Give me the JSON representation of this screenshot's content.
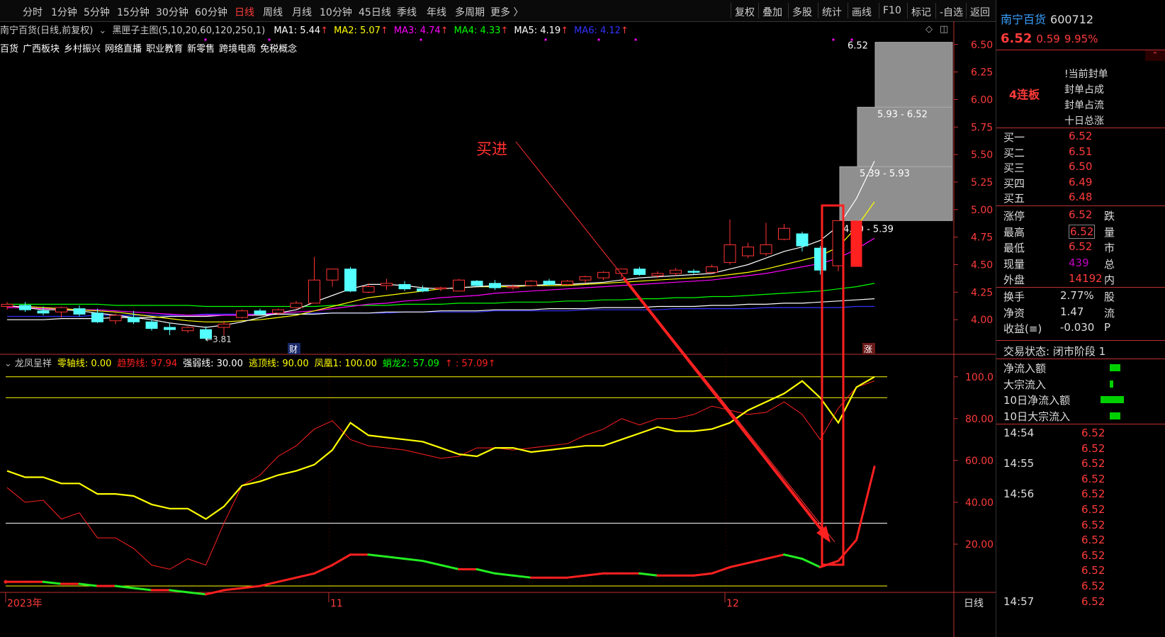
{
  "toolbar": {
    "periods": [
      "分时",
      "1分钟",
      "5分钟",
      "15分钟",
      "30分钟",
      "60分钟",
      "日线",
      "周线",
      "月线",
      "10分钟",
      "45日线",
      "季线",
      "年线",
      "多周期",
      "更多 〉"
    ],
    "active_period": "日线",
    "tools": [
      "复权",
      "叠加",
      "多股",
      "统计",
      "画线",
      "F10",
      "标记",
      "-自选",
      "返回"
    ]
  },
  "main_info": {
    "title": "南宁百货(日线,前复权)",
    "indicator": "黑匣子主图(5,10,20,60,120,250,1)",
    "ma": [
      {
        "label": "MA1: 5.44",
        "color": "#ffffff"
      },
      {
        "label": "MA2: 5.07",
        "color": "#ffff00"
      },
      {
        "label": "MA3: 4.74",
        "color": "#ff00ff"
      },
      {
        "label": "MA4: 4.33",
        "color": "#00ff00"
      },
      {
        "label": "MA5: 4.19",
        "color": "#ffffff"
      },
      {
        "label": "MA6: 4.12",
        "color": "#3333ff"
      }
    ]
  },
  "concepts": [
    "百货",
    "广西板块",
    "乡村振兴",
    "网络直播",
    "职业教育",
    "新零售",
    "跨境电商",
    "免税概念"
  ],
  "price_axis": [
    "6.50",
    "6.25",
    "6.00",
    "5.75",
    "5.50",
    "5.25",
    "5.00",
    "4.75",
    "4.50",
    "4.25",
    "4.00"
  ],
  "indicator_axis": [
    "100.0",
    "80.00",
    "60.00",
    "40.00",
    "20.00"
  ],
  "x_axis": [
    "2023年",
    "11",
    "12",
    "日线"
  ],
  "annotations": {
    "buy": "买进",
    "low": "3.81",
    "cai": "财",
    "zhang": "涨"
  },
  "ladder": [
    {
      "label": "6.52"
    },
    {
      "label": "5.93 - 6.52"
    },
    {
      "label": "5.39 - 5.93"
    },
    {
      "label": "4.90 - 5.39"
    }
  ],
  "indicator_legend": [
    {
      "label": "龙凤呈祥",
      "color": "#cccccc"
    },
    {
      "label": "零轴线: 0.00",
      "color": "#ffff00"
    },
    {
      "label": "趋势线: 97.94",
      "color": "#ff2020"
    },
    {
      "label": "强弱线: 30.00",
      "color": "#ffffff"
    },
    {
      "label": "逃顶线: 90.00",
      "color": "#ffff00"
    },
    {
      "label": "凤凰1: 100.00",
      "color": "#ffff00"
    },
    {
      "label": "蛸龙2: 57.09",
      "color": "#00ff00"
    },
    {
      "label": "↑ : 57.09↑",
      "color": "#ff2020"
    }
  ],
  "chart_data": {
    "type": "candlestick",
    "price_range": [
      3.75,
      6.55
    ],
    "candles": [
      {
        "o": 4.12,
        "h": 4.16,
        "l": 4.09,
        "c": 4.14
      },
      {
        "o": 4.13,
        "h": 4.16,
        "l": 4.07,
        "c": 4.09
      },
      {
        "o": 4.08,
        "h": 4.12,
        "l": 4.04,
        "c": 4.06
      },
      {
        "o": 4.07,
        "h": 4.12,
        "l": 4.02,
        "c": 4.11
      },
      {
        "o": 4.1,
        "h": 4.13,
        "l": 4.03,
        "c": 4.05
      },
      {
        "o": 4.06,
        "h": 4.1,
        "l": 3.97,
        "c": 3.98
      },
      {
        "o": 3.99,
        "h": 4.06,
        "l": 3.96,
        "c": 4.04
      },
      {
        "o": 4.02,
        "h": 4.08,
        "l": 3.96,
        "c": 3.98
      },
      {
        "o": 3.98,
        "h": 4.0,
        "l": 3.9,
        "c": 3.92
      },
      {
        "o": 3.93,
        "h": 3.97,
        "l": 3.86,
        "c": 3.91
      },
      {
        "o": 3.9,
        "h": 3.94,
        "l": 3.88,
        "c": 3.93
      },
      {
        "o": 3.91,
        "h": 3.94,
        "l": 3.81,
        "c": 3.83
      },
      {
        "o": 3.93,
        "h": 3.99,
        "l": 3.86,
        "c": 3.96
      },
      {
        "o": 4.02,
        "h": 4.09,
        "l": 4.01,
        "c": 4.08
      },
      {
        "o": 4.08,
        "h": 4.1,
        "l": 4.04,
        "c": 4.05
      },
      {
        "o": 4.06,
        "h": 4.1,
        "l": 4.04,
        "c": 4.09
      },
      {
        "o": 4.11,
        "h": 4.17,
        "l": 4.1,
        "c": 4.15
      },
      {
        "o": 4.15,
        "h": 4.57,
        "l": 4.15,
        "c": 4.36
      },
      {
        "o": 4.36,
        "h": 4.45,
        "l": 4.3,
        "c": 4.46
      },
      {
        "o": 4.46,
        "h": 4.48,
        "l": 4.25,
        "c": 4.26
      },
      {
        "o": 4.25,
        "h": 4.33,
        "l": 4.24,
        "c": 4.3
      },
      {
        "o": 4.31,
        "h": 4.37,
        "l": 4.27,
        "c": 4.33
      },
      {
        "o": 4.32,
        "h": 4.35,
        "l": 4.26,
        "c": 4.28
      },
      {
        "o": 4.28,
        "h": 4.31,
        "l": 4.25,
        "c": 4.26
      },
      {
        "o": 4.28,
        "h": 4.3,
        "l": 4.26,
        "c": 4.29
      },
      {
        "o": 4.26,
        "h": 4.37,
        "l": 4.26,
        "c": 4.36
      },
      {
        "o": 4.35,
        "h": 4.36,
        "l": 4.3,
        "c": 4.31
      },
      {
        "o": 4.33,
        "h": 4.36,
        "l": 4.27,
        "c": 4.29
      },
      {
        "o": 4.29,
        "h": 4.32,
        "l": 4.27,
        "c": 4.3
      },
      {
        "o": 4.31,
        "h": 4.36,
        "l": 4.3,
        "c": 4.35
      },
      {
        "o": 4.35,
        "h": 4.37,
        "l": 4.31,
        "c": 4.32
      },
      {
        "o": 4.32,
        "h": 4.36,
        "l": 4.31,
        "c": 4.35
      },
      {
        "o": 4.36,
        "h": 4.4,
        "l": 4.33,
        "c": 4.39
      },
      {
        "o": 4.38,
        "h": 4.44,
        "l": 4.36,
        "c": 4.43
      },
      {
        "o": 4.42,
        "h": 4.46,
        "l": 4.38,
        "c": 4.46
      },
      {
        "o": 4.46,
        "h": 4.48,
        "l": 4.4,
        "c": 4.41
      },
      {
        "o": 4.4,
        "h": 4.44,
        "l": 4.38,
        "c": 4.42
      },
      {
        "o": 4.42,
        "h": 4.47,
        "l": 4.4,
        "c": 4.45
      },
      {
        "o": 4.44,
        "h": 4.46,
        "l": 4.41,
        "c": 4.43
      },
      {
        "o": 4.43,
        "h": 4.5,
        "l": 4.42,
        "c": 4.48
      },
      {
        "o": 4.52,
        "h": 4.91,
        "l": 4.5,
        "c": 4.68
      },
      {
        "o": 4.58,
        "h": 4.7,
        "l": 4.56,
        "c": 4.66
      },
      {
        "o": 4.6,
        "h": 4.88,
        "l": 4.58,
        "c": 4.68
      },
      {
        "o": 4.73,
        "h": 4.87,
        "l": 4.72,
        "c": 4.83
      },
      {
        "o": 4.78,
        "h": 4.8,
        "l": 4.62,
        "c": 4.67
      },
      {
        "o": 4.65,
        "h": 4.67,
        "l": 4.41,
        "c": 4.45
      },
      {
        "o": 4.49,
        "h": 4.9,
        "l": 4.44,
        "c": 4.9
      }
    ],
    "ma1": [
      4.13,
      4.11,
      4.09,
      4.09,
      4.08,
      4.06,
      4.04,
      4.02,
      4.0,
      3.97,
      3.95,
      3.93,
      3.95,
      3.98,
      4.02,
      4.06,
      4.09,
      4.16,
      4.22,
      4.28,
      4.32,
      4.32,
      4.31,
      4.29,
      4.28,
      4.29,
      4.3,
      4.31,
      4.31,
      4.31,
      4.32,
      4.32,
      4.33,
      4.34,
      4.36,
      4.38,
      4.39,
      4.4,
      4.41,
      4.42,
      4.46,
      4.5,
      4.56,
      4.62,
      4.66,
      4.72,
      4.85,
      5.1,
      5.44
    ],
    "ma2": [
      4.12,
      4.12,
      4.11,
      4.1,
      4.09,
      4.08,
      4.07,
      4.05,
      4.03,
      4.01,
      3.99,
      3.98,
      3.98,
      3.99,
      4.0,
      4.02,
      4.04,
      4.08,
      4.12,
      4.16,
      4.2,
      4.22,
      4.24,
      4.26,
      4.28,
      4.29,
      4.3,
      4.3,
      4.3,
      4.31,
      4.31,
      4.31,
      4.32,
      4.33,
      4.34,
      4.35,
      4.36,
      4.37,
      4.38,
      4.39,
      4.41,
      4.43,
      4.46,
      4.5,
      4.54,
      4.58,
      4.66,
      4.84,
      5.07
    ],
    "ma3": [
      4.11,
      4.11,
      4.1,
      4.1,
      4.09,
      4.09,
      4.08,
      4.07,
      4.06,
      4.05,
      4.04,
      4.04,
      4.04,
      4.04,
      4.05,
      4.06,
      4.07,
      4.08,
      4.1,
      4.12,
      4.14,
      4.15,
      4.17,
      4.18,
      4.2,
      4.21,
      4.22,
      4.24,
      4.25,
      4.26,
      4.27,
      4.28,
      4.29,
      4.3,
      4.31,
      4.32,
      4.33,
      4.34,
      4.35,
      4.36,
      4.38,
      4.4,
      4.42,
      4.45,
      4.48,
      4.51,
      4.56,
      4.64,
      4.74
    ],
    "ma4": [
      4.14,
      4.14,
      4.14,
      4.14,
      4.14,
      4.14,
      4.13,
      4.13,
      4.13,
      4.13,
      4.13,
      4.12,
      4.12,
      4.12,
      4.12,
      4.12,
      4.12,
      4.12,
      4.13,
      4.13,
      4.13,
      4.13,
      4.14,
      4.14,
      4.14,
      4.15,
      4.15,
      4.15,
      4.16,
      4.16,
      4.16,
      4.17,
      4.17,
      4.18,
      4.18,
      4.19,
      4.19,
      4.2,
      4.2,
      4.21,
      4.21,
      4.22,
      4.23,
      4.24,
      4.25,
      4.26,
      4.28,
      4.3,
      4.33
    ],
    "ma5": [
      4.0,
      4.0,
      4.0,
      4.01,
      4.01,
      4.01,
      4.02,
      4.02,
      4.02,
      4.03,
      4.03,
      4.03,
      4.04,
      4.04,
      4.04,
      4.05,
      4.05,
      4.05,
      4.06,
      4.06,
      4.06,
      4.07,
      4.07,
      4.07,
      4.08,
      4.08,
      4.08,
      4.09,
      4.09,
      4.09,
      4.1,
      4.1,
      4.1,
      4.11,
      4.11,
      4.11,
      4.12,
      4.12,
      4.12,
      4.13,
      4.13,
      4.14,
      4.14,
      4.15,
      4.15,
      4.16,
      4.17,
      4.18,
      4.19
    ],
    "ma6": [
      4.03,
      4.03,
      4.03,
      4.03,
      4.03,
      4.04,
      4.04,
      4.04,
      4.04,
      4.04,
      4.04,
      4.05,
      4.05,
      4.05,
      4.05,
      4.05,
      4.05,
      4.06,
      4.06,
      4.06,
      4.06,
      4.06,
      4.07,
      4.07,
      4.07,
      4.07,
      4.07,
      4.08,
      4.08,
      4.08,
      4.08,
      4.08,
      4.09,
      4.09,
      4.09,
      4.09,
      4.09,
      4.1,
      4.1,
      4.1,
      4.1,
      4.1,
      4.11,
      4.11,
      4.11,
      4.11,
      4.11,
      4.12,
      4.12
    ],
    "indicator_range": [
      0,
      105
    ],
    "lines": {
      "zero_axis": 0,
      "strength_line": 30,
      "escape_line": 90,
      "phoenix": 100
    },
    "trend_line": [
      47,
      40,
      41,
      32,
      35,
      23,
      23,
      18,
      10,
      8,
      13,
      10,
      30,
      48,
      53,
      62,
      67,
      75,
      79,
      70,
      67,
      66,
      65,
      63,
      61,
      62,
      66,
      66,
      65,
      66,
      67,
      68,
      72,
      75,
      80,
      77,
      80,
      80,
      82,
      86,
      84,
      82,
      83,
      88,
      82,
      70,
      85,
      95,
      98
    ],
    "yellow_line": [
      55,
      52,
      52,
      49,
      49,
      44,
      44,
      43,
      39,
      37,
      37,
      32,
      38,
      48,
      50,
      53,
      55,
      58,
      65,
      78,
      72,
      71,
      70,
      69,
      66,
      63,
      62,
      66,
      66,
      64,
      65,
      66,
      67,
      67,
      70,
      73,
      76,
      74,
      74,
      75,
      78,
      84,
      88,
      92,
      98,
      90,
      78,
      95,
      100
    ],
    "dragon_line": [
      2,
      2,
      2,
      1,
      1,
      0,
      0,
      -1,
      -2,
      -2,
      -3,
      -4,
      -2,
      -1,
      0,
      2,
      4,
      6,
      10,
      15,
      15,
      14,
      13,
      12,
      10,
      8,
      8,
      6,
      5,
      4,
      4,
      4,
      5,
      6,
      6,
      6,
      5,
      5,
      5,
      6,
      9,
      11,
      13,
      15,
      13,
      9,
      12,
      22,
      57
    ],
    "dragon_red_from_index": 45
  },
  "right_panel": {
    "name": "南宁百货",
    "code": "600712",
    "price": "6.52",
    "change": "0.59",
    "pct": "9.95%",
    "board": "4连板",
    "board_notes": [
      "!当前封单",
      "封单占成",
      "封单占流",
      "十日总涨"
    ],
    "orders": [
      {
        "label": "买一",
        "price": "6.52"
      },
      {
        "label": "买二",
        "price": "6.51"
      },
      {
        "label": "买三",
        "price": "6.50"
      },
      {
        "label": "买四",
        "price": "6.49"
      },
      {
        "label": "买五",
        "price": "6.48"
      }
    ],
    "stats1": [
      {
        "label": "涨停",
        "value": "6.52",
        "tail": "跌"
      },
      {
        "label": "最高",
        "value": "6.52",
        "tail": "量"
      },
      {
        "label": "最低",
        "value": "6.52",
        "tail": "市"
      },
      {
        "label": "现量",
        "value": "439",
        "tail": "总"
      },
      {
        "label": "外盘",
        "value": "14192",
        "tail": "内"
      }
    ],
    "stats2": [
      {
        "label": "换手",
        "value": "2.77%",
        "tail": "股"
      },
      {
        "label": "净资",
        "value": "1.47",
        "tail": "流"
      },
      {
        "label": "收益(≡)",
        "value": "-0.030",
        "tail": "P"
      }
    ],
    "trade_status": "交易状态: 闭市阶段 1",
    "flows": [
      {
        "label": "净流入额",
        "bar": 0.25
      },
      {
        "label": "大宗流入",
        "bar": 0.08
      },
      {
        "label": "10日净流入额",
        "bar": 0.55
      },
      {
        "label": "10日大宗流入",
        "bar": 0.25
      }
    ],
    "ticks": [
      {
        "time": "14:54",
        "price": "6.52"
      },
      {
        "time": "",
        "price": "6.52"
      },
      {
        "time": "14:55",
        "price": "6.52"
      },
      {
        "time": "",
        "price": "6.52"
      },
      {
        "time": "14:56",
        "price": "6.52"
      },
      {
        "time": "",
        "price": "6.52"
      },
      {
        "time": "",
        "price": "6.52"
      },
      {
        "time": "",
        "price": "6.52"
      },
      {
        "time": "",
        "price": "6.52"
      },
      {
        "time": "",
        "price": "6.52"
      },
      {
        "time": "",
        "price": "6.52"
      },
      {
        "time": "14:57",
        "price": "6.52"
      }
    ]
  }
}
